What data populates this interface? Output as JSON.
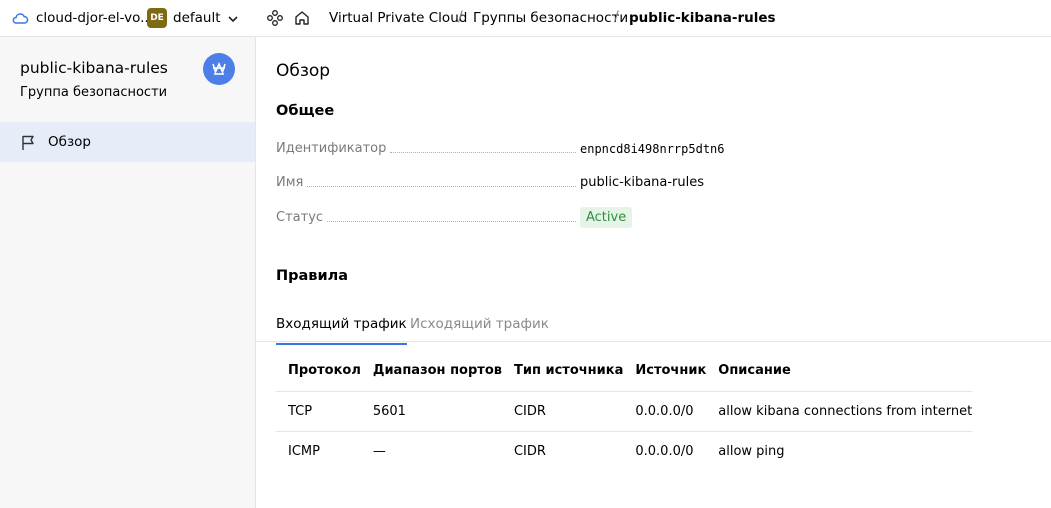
{
  "topbar": {
    "cloud_name": "cloud-djor-el-vo...",
    "folder_badge": "DE",
    "folder_name": "default",
    "breadcrumbs": [
      "Virtual Private Cloud",
      "Группы безопасности",
      "public-kibana-rules"
    ],
    "separator": "/"
  },
  "sidebar": {
    "title": "public-kibana-rules",
    "subtitle": "Группа безопасности",
    "items": [
      {
        "label": "Обзор",
        "icon": "flag-icon"
      }
    ]
  },
  "main": {
    "title": "Обзор",
    "general": {
      "heading": "Общее",
      "fields": [
        {
          "label": "Идентификатор",
          "value": "enpncd8i498nrrp5dtn6"
        },
        {
          "label": "Имя",
          "value": "public-kibana-rules"
        },
        {
          "label": "Статус",
          "value": "Active"
        }
      ]
    },
    "rules": {
      "heading": "Правила",
      "tabs": [
        "Входящий трафик",
        "Исходящий трафик"
      ],
      "columns": [
        "Протокол",
        "Диапазон портов",
        "Тип источника",
        "Источник",
        "Описание"
      ],
      "rows": [
        [
          "TCP",
          "5601",
          "CIDR",
          "0.0.0.0/0",
          "allow kibana connections from internet"
        ],
        [
          "ICMP",
          "—",
          "CIDR",
          "0.0.0.0/0",
          "allow ping"
        ]
      ]
    }
  },
  "colors": {
    "accent": "#3a75e6",
    "status_active_bg": "#e5f4e7",
    "status_active_text": "#2f8f3f",
    "folder_badge_bg": "#7f6a14",
    "sidebar_selected_bg": "#e6ecf8"
  }
}
